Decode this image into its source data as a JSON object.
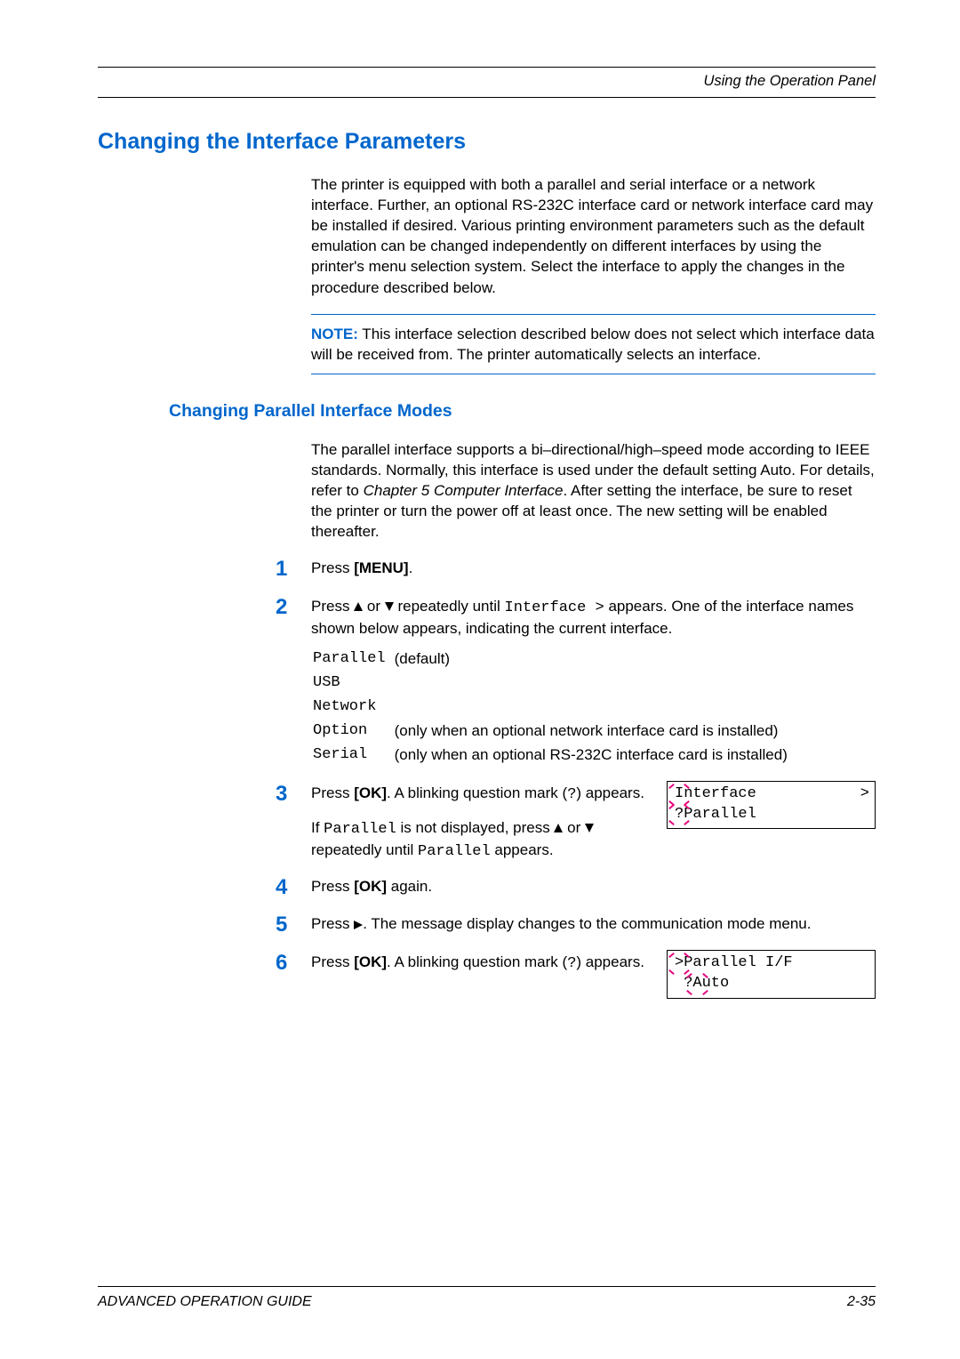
{
  "header": {
    "section": "Using the Operation Panel"
  },
  "title": "Changing the Interface Parameters",
  "intro": "The printer is equipped with both a parallel and serial interface or a network interface. Further, an optional RS-232C interface card or network interface card may be installed if desired. Various printing environment parameters such as the default emulation can be changed independently on different interfaces by using the printer's menu selection system. Select the interface to apply the changes in the procedure described below.",
  "note": {
    "label": "NOTE:",
    "text": " This interface selection described below does not select which interface data will be received from. The printer automatically selects an interface."
  },
  "h2": "Changing Parallel Interface Modes",
  "p2a": "The parallel interface supports a bi–directional/high–speed mode according to IEEE standards. Normally, this interface is used under the default setting Auto. For details, refer to ",
  "p2b": "Chapter 5 Computer Interface",
  "p2c": ". After setting the interface, be sure to reset the printer or turn the power off at least once. The new setting will be enabled thereafter.",
  "s1": {
    "num": "1",
    "a": "Press ",
    "b": "[MENU]",
    "c": "."
  },
  "s2": {
    "num": "2",
    "a": "Press ",
    "b": " or ",
    "c": " repeatedly until ",
    "code": "Interface >",
    "d": " appears. One of the interface names shown below appears, indicating the current interface.",
    "opt": {
      "r1c1": "Parallel",
      "r1c2": "(default)",
      "r2c1": "USB",
      "r3c1": "Network",
      "r4c1": "Option",
      "r4c2": "(only when an optional network interface card is installed)",
      "r5c1": "Serial",
      "r5c2": "(only when an optional RS-232C interface card is installed)"
    }
  },
  "s3": {
    "num": "3",
    "a": "Press ",
    "ok": "[OK]",
    "b": ". A blinking question mark (",
    "q": "?",
    "c": ") appears.",
    "d": "If ",
    "code1": "Parallel",
    "e": " is not displayed, press ",
    "f": " or ",
    "g": " repeatedly until ",
    "code2": "Parallel",
    "h": " appears.",
    "disp1_pre": "I",
    "disp1_post": "nterface",
    "disp1_r": ">",
    "disp2_pre": "?",
    "disp2_post": "Parallel"
  },
  "s4": {
    "num": "4",
    "a": "Press ",
    "b": "[OK]",
    "c": " again."
  },
  "s5": {
    "num": "5",
    "a": "Press ",
    "b": ". The message display changes to the communication mode menu."
  },
  "s6": {
    "num": "6",
    "a": "Press ",
    "b": "[OK]",
    "c": ". A blinking question mark (",
    "q": "?",
    "d": ") appears.",
    "disp1_pre": ">",
    "disp1_post": "Parallel I/F",
    "disp2_pre": "?",
    "disp2_mid": "A",
    "disp2_post": "uto"
  },
  "footer": {
    "left": "ADVANCED OPERATION GUIDE",
    "right": "2-35"
  }
}
